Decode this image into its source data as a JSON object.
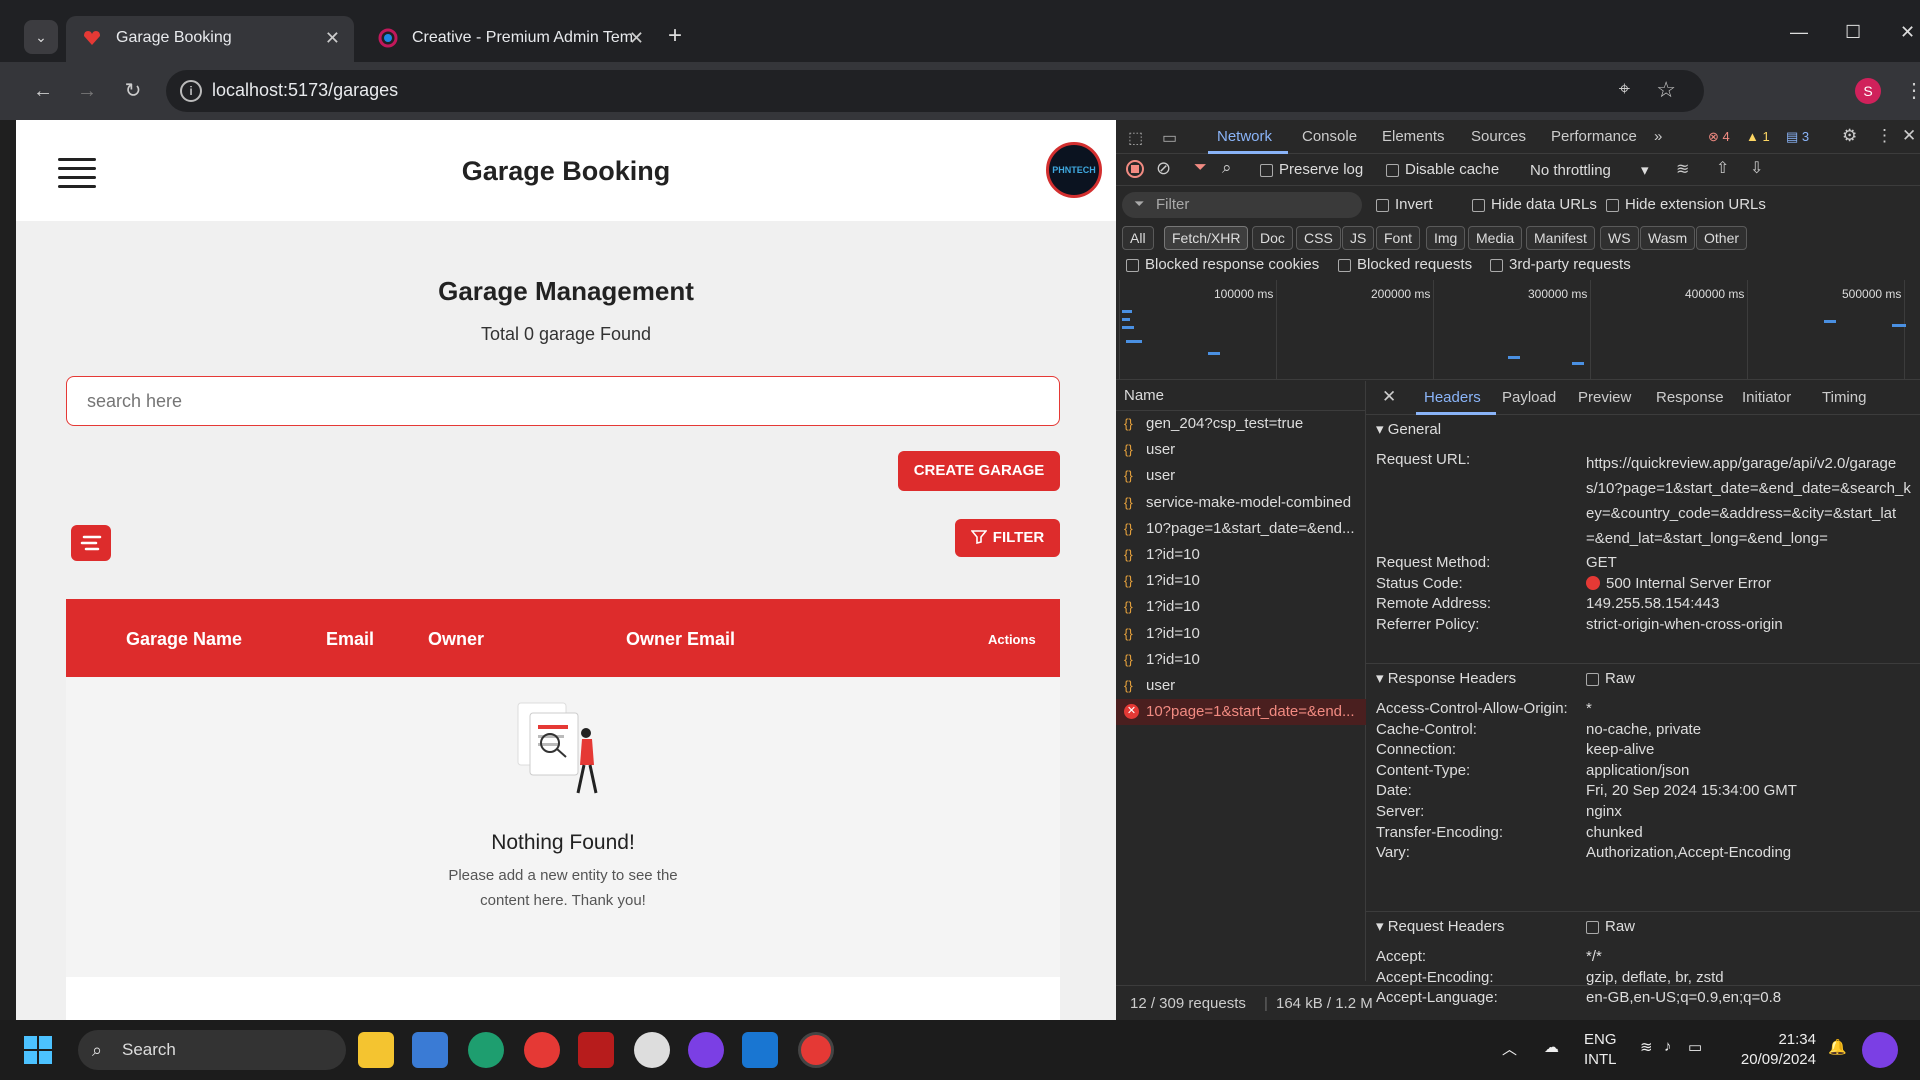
{
  "browser": {
    "tabs": [
      {
        "title": "Garage Booking",
        "active": true
      },
      {
        "title": "Creative - Premium Admin Tem",
        "active": false
      }
    ],
    "url": "localhost:5173/garages",
    "profile_initial": "S"
  },
  "app": {
    "header_title": "Garage Booking",
    "logo_text": "PHNTECH",
    "page_title": "Garage Management",
    "subtitle": "Total 0 garage Found",
    "search_placeholder": "search here",
    "create_button": "CREATE GARAGE",
    "filter_button": "FILTER",
    "table_headers": [
      "Garage Name",
      "Email",
      "Owner",
      "Owner Email",
      "Actions"
    ],
    "empty_title": "Nothing Found!",
    "empty_line1": "Please add a new entity to see the",
    "empty_line2": "content here. Thank you!"
  },
  "devtools": {
    "panel_tabs": [
      "Network",
      "Console",
      "Elements",
      "Sources",
      "Performance"
    ],
    "errors": "4",
    "warnings": "1",
    "messages": "3",
    "preserve_log": "Preserve log",
    "disable_cache": "Disable cache",
    "throttling": "No throttling",
    "filter_placeholder": "Filter",
    "invert": "Invert",
    "hide_data_urls": "Hide data URLs",
    "hide_ext_urls": "Hide extension URLs",
    "type_filters": [
      "All",
      "Fetch/XHR",
      "Doc",
      "CSS",
      "JS",
      "Font",
      "Img",
      "Media",
      "Manifest",
      "WS",
      "Wasm",
      "Other"
    ],
    "blocked_cookies": "Blocked response cookies",
    "blocked_requests": "Blocked requests",
    "third_party": "3rd-party requests",
    "timeline_labels": [
      "100000 ms",
      "200000 ms",
      "300000 ms",
      "400000 ms",
      "500000 ms"
    ],
    "name_header": "Name",
    "requests": [
      {
        "name": "gen_204?csp_test=true",
        "error": false
      },
      {
        "name": "user",
        "error": false
      },
      {
        "name": "user",
        "error": false
      },
      {
        "name": "service-make-model-combined",
        "error": false
      },
      {
        "name": "10?page=1&start_date=&end...",
        "error": false
      },
      {
        "name": "1?id=10",
        "error": false
      },
      {
        "name": "1?id=10",
        "error": false
      },
      {
        "name": "1?id=10",
        "error": false
      },
      {
        "name": "1?id=10",
        "error": false
      },
      {
        "name": "1?id=10",
        "error": false
      },
      {
        "name": "user",
        "error": false
      },
      {
        "name": "10?page=1&start_date=&end...",
        "error": true
      }
    ],
    "detail_tabs": [
      "Headers",
      "Payload",
      "Preview",
      "Response",
      "Initiator",
      "Timing"
    ],
    "general_label": "General",
    "request_url_key": "Request URL:",
    "request_url_lines": [
      "https://quickreview.app/garage/api/v2.0/garage",
      "s/10?page=1&start_date=&end_date=&search_k",
      "ey=&country_code=&address=&city=&start_lat",
      "=&end_lat=&start_long=&end_long="
    ],
    "general": [
      {
        "k": "Request Method:",
        "v": "GET"
      },
      {
        "k": "Status Code:",
        "v": "500 Internal Server Error"
      },
      {
        "k": "Remote Address:",
        "v": "149.255.58.154:443"
      },
      {
        "k": "Referrer Policy:",
        "v": "strict-origin-when-cross-origin"
      }
    ],
    "response_headers_label": "Response Headers",
    "raw_label": "Raw",
    "response_headers": [
      {
        "k": "Access-Control-Allow-Origin:",
        "v": "*"
      },
      {
        "k": "Cache-Control:",
        "v": "no-cache, private"
      },
      {
        "k": "Connection:",
        "v": "keep-alive"
      },
      {
        "k": "Content-Type:",
        "v": "application/json"
      },
      {
        "k": "Date:",
        "v": "Fri, 20 Sep 2024 15:34:00 GMT"
      },
      {
        "k": "Server:",
        "v": "nginx"
      },
      {
        "k": "Transfer-Encoding:",
        "v": "chunked"
      },
      {
        "k": "Vary:",
        "v": "Authorization,Accept-Encoding"
      }
    ],
    "request_headers_label": "Request Headers",
    "request_headers": [
      {
        "k": "Accept:",
        "v": "*/*"
      },
      {
        "k": "Accept-Encoding:",
        "v": "gzip, deflate, br, zstd"
      },
      {
        "k": "Accept-Language:",
        "v": "en-GB,en-US;q=0.9,en;q=0.8"
      }
    ],
    "status_requests": "12 / 309 requests",
    "status_transfer": "164 kB / 1.2 M"
  },
  "taskbar": {
    "search_label": "Search",
    "lang_line1": "ENG",
    "lang_line2": "INTL",
    "time": "21:34",
    "date": "20/09/2024"
  },
  "colors": {
    "accent_red": "#dd2c2c",
    "devtools_blue": "#8ab4f8"
  }
}
